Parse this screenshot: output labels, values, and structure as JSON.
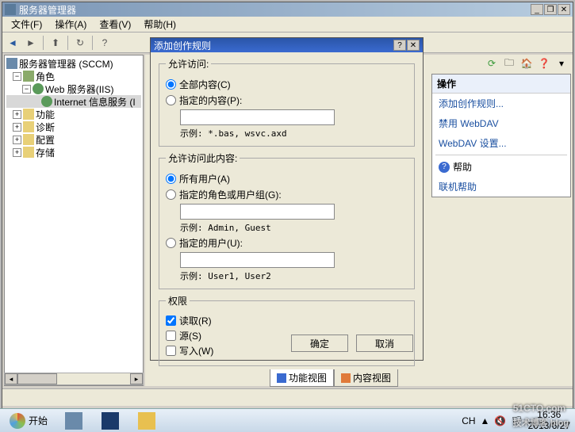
{
  "window": {
    "title": "服务器管理器",
    "min": "_",
    "max": "❐",
    "close": "✕"
  },
  "menu": {
    "file": "文件(F)",
    "action": "操作(A)",
    "view": "查看(V)",
    "help": "帮助(H)"
  },
  "tree": {
    "root": "服务器管理器 (SCCM)",
    "roles": "角色",
    "web": "Web 服务器(IIS)",
    "iis": "Internet 信息服务 (I",
    "features": "功能",
    "diag": "诊断",
    "config": "配置",
    "storage": "存储"
  },
  "dialog": {
    "title": "添加创作规则",
    "help": "?",
    "close": "✕",
    "allowAccess": "允许访问:",
    "allContent": "全部内容(C)",
    "specContent": "指定的内容(P):",
    "hint1": "示例: *.bas, wsvc.axd",
    "allowAccessTo": "允许访问此内容:",
    "allUsers": "所有用户(A)",
    "specRoles": "指定的角色或用户组(G):",
    "hint2": "示例: Admin, Guest",
    "specUsers": "指定的用户(U):",
    "hint3": "示例: User1, User2",
    "perms": "权限",
    "read": "读取(R)",
    "source": "源(S)",
    "write": "写入(W)",
    "ok": "确定",
    "cancel": "取消"
  },
  "actions": {
    "title": "操作",
    "addRule": "添加创作规则...",
    "disable": "禁用 WebDAV",
    "settings": "WebDAV 设置...",
    "help": "帮助",
    "online": "联机帮助"
  },
  "tabs": {
    "func": "功能视图",
    "content": "内容视图"
  },
  "taskbar": {
    "start": "开始",
    "ime": "CH",
    "arrow": "▲",
    "net": "🔇",
    "flag": "🏳",
    "time": "16:36",
    "date": "2013/6/27"
  },
  "watermark": {
    "site": "51CTO.com",
    "sub": "技术博客 blog"
  }
}
